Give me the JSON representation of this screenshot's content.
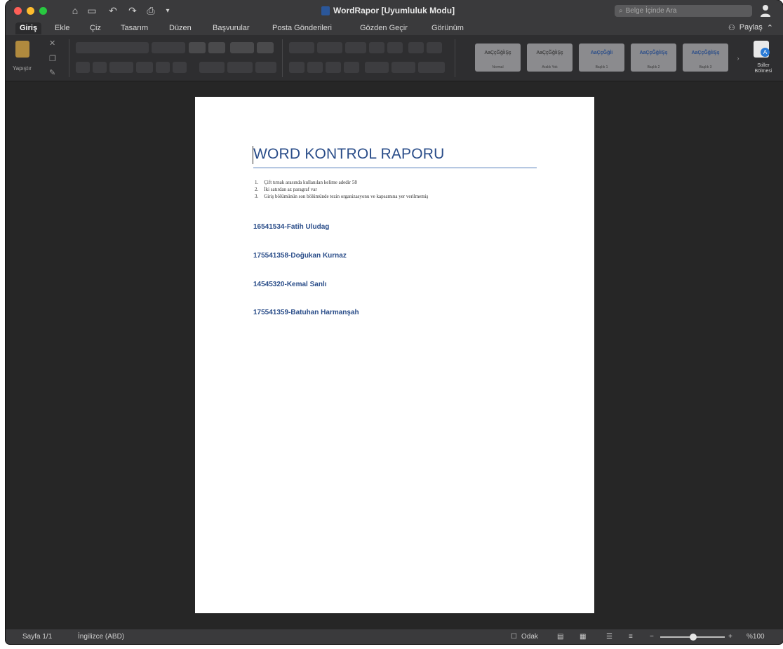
{
  "window": {
    "title": "WordRapor [Uyumluluk Modu]",
    "search_placeholder": "Belge İçinde Ara"
  },
  "tabs": [
    "Giriş",
    "Ekle",
    "Çiz",
    "Tasarım",
    "Düzen",
    "Başvurular",
    "Posta Gönderileri",
    "Gözden Geçir",
    "Görünüm"
  ],
  "share_label": "Paylaş",
  "ribbon": {
    "paste_label": "Yapıştır",
    "styles": [
      {
        "sample": "AaÇçĞğİiŞş",
        "name": "Normal"
      },
      {
        "sample": "AaÇçĞğİiŞş",
        "name": "Aralık Yok"
      },
      {
        "sample": "AaÇçĞğİi",
        "name": "Başlık 1"
      },
      {
        "sample": "AaÇçĞğİiŞş",
        "name": "Başlık 2"
      },
      {
        "sample": "AaÇçĞğİiŞş",
        "name": "Başlık 3"
      }
    ],
    "styles_pane_label": "Stiller Bölmesi"
  },
  "document": {
    "heading": "WORD KONTROL RAPORU",
    "list": [
      {
        "num": "1.",
        "text": "Çift tırnak arasında kullanılan kelime adedir 58"
      },
      {
        "num": "2.",
        "text": "İki satırdan az paragraf var"
      },
      {
        "num": "3.",
        "text": "Giriş bölümünün son bölümünde tezin organizasyonu ve kapsamına yer verilmemiş"
      }
    ],
    "members": [
      "16541534-Fatih Uludag",
      "175541358-Doğukan Kurnaz",
      "14545320-Kemal Sanlı",
      "175541359-Batuhan Harmanşah"
    ]
  },
  "statusbar": {
    "page": "Sayfa 1/1",
    "language": "İngilizce (ABD)",
    "focus": "Odak",
    "zoom": "%100"
  }
}
